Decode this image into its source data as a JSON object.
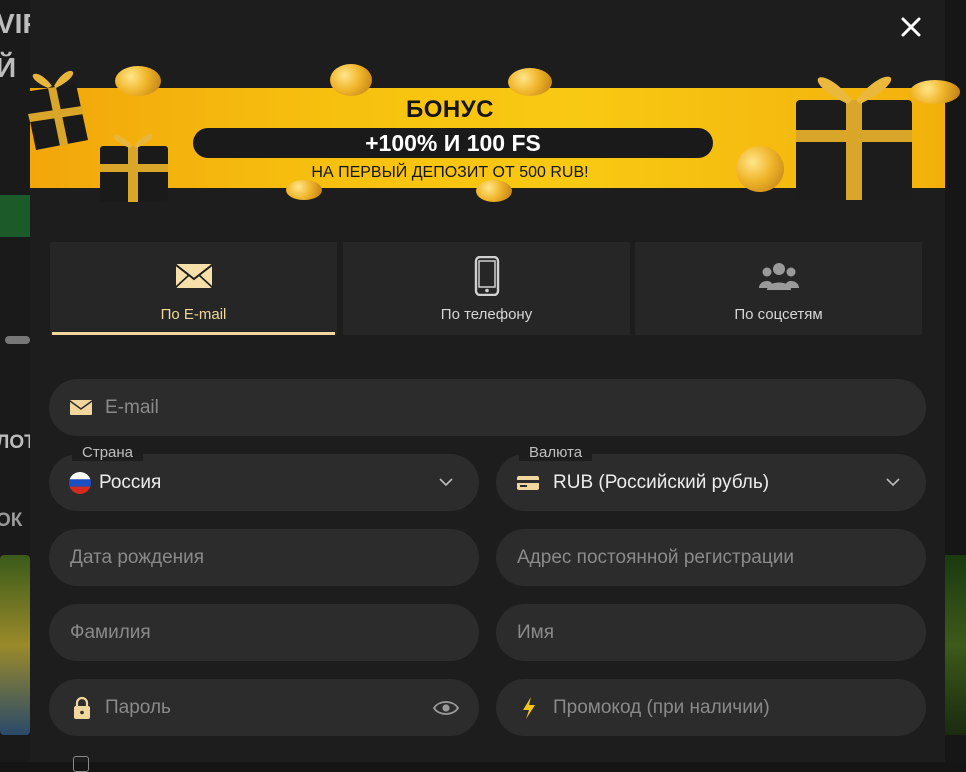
{
  "background": {
    "fragments": [
      "VIP",
      "Й",
      "ЛОТ",
      "ОК"
    ]
  },
  "banner": {
    "title": "БОНУС",
    "offer": "+100% И 100 FS",
    "subtitle": "НА ПЕРВЫЙ ДЕПОЗИТ ОТ 500 RUB!"
  },
  "tabs": [
    {
      "label": "По E-mail",
      "icon": "envelope-icon",
      "active": true
    },
    {
      "label": "По телефону",
      "icon": "phone-icon",
      "active": false
    },
    {
      "label": "По соцсетям",
      "icon": "users-icon",
      "active": false
    }
  ],
  "form": {
    "email": {
      "placeholder": "E-mail"
    },
    "country": {
      "label": "Страна",
      "value": "Россия"
    },
    "currency": {
      "label": "Валюта",
      "value": "RUB (Российский рубль)"
    },
    "birthdate": {
      "placeholder": "Дата рождения"
    },
    "address": {
      "placeholder": "Адрес постоянной регистрации"
    },
    "lastname": {
      "placeholder": "Фамилия"
    },
    "firstname": {
      "placeholder": "Имя"
    },
    "password": {
      "placeholder": "Пароль"
    },
    "promo": {
      "placeholder": "Промокод (при наличии)"
    }
  },
  "colors": {
    "accent": "#f2d8a0",
    "banner": "#f7c20f",
    "modal_bg": "#1d1d1d",
    "field_bg": "#2c2c2c",
    "promo_icon": "#f5c518"
  }
}
